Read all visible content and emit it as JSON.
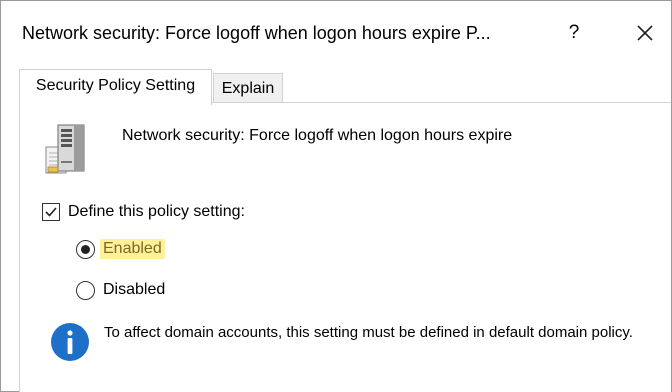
{
  "window": {
    "title": "Network security: Force logoff when logon hours expire P...",
    "help_label": "?",
    "close_icon": "close-icon"
  },
  "tabs": [
    {
      "label": "Security Policy Setting",
      "active": true
    },
    {
      "label": "Explain",
      "active": false
    }
  ],
  "policy": {
    "icon": "server-icon",
    "name": "Network security: Force logoff when logon hours expire"
  },
  "define": {
    "label": "Define this policy setting:",
    "checked": true
  },
  "options": {
    "enabled_label": "Enabled",
    "disabled_label": "Disabled",
    "selected": "Enabled",
    "highlight_color": "#fff19a"
  },
  "info": {
    "icon": "info-icon",
    "text": "To affect domain accounts, this setting must be defined in default domain policy.",
    "icon_color": "#1e6fc8"
  }
}
